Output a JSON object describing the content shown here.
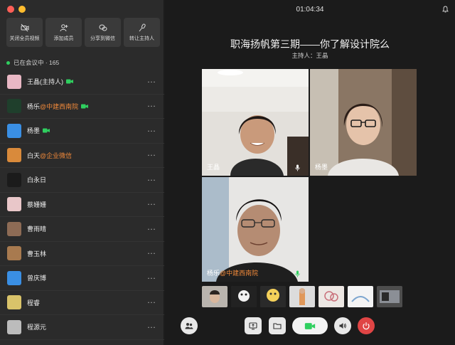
{
  "sidebar": {
    "actions": [
      {
        "label": "关闭全员视频",
        "icon": "camera-off-icon"
      },
      {
        "label": "添加成员",
        "icon": "add-user-icon"
      },
      {
        "label": "分享到微信",
        "icon": "wechat-icon"
      },
      {
        "label": "转让主持人",
        "icon": "microphone-icon"
      }
    ],
    "status": "已在会议中 · 165",
    "members": [
      {
        "name": "王晶(主持人)",
        "org": "",
        "camera": true,
        "avatar_color": "#e8b7c4"
      },
      {
        "name": "杨乐",
        "org": "@中建西南院",
        "camera": true,
        "avatar_color": "#1f3f2c"
      },
      {
        "name": "杨墨",
        "org": "",
        "camera": true,
        "avatar_color": "#3a8fe4"
      },
      {
        "name": "白天",
        "org": "@企业微信",
        "camera": false,
        "avatar_color": "#d98a3b"
      },
      {
        "name": "白永日",
        "org": "",
        "camera": false,
        "avatar_color": "#1b1b1b"
      },
      {
        "name": "蔡姗姗",
        "org": "",
        "camera": false,
        "avatar_color": "#e9c7c9"
      },
      {
        "name": "曹雨晴",
        "org": "",
        "camera": false,
        "avatar_color": "#8d6b55"
      },
      {
        "name": "曹玉林",
        "org": "",
        "camera": false,
        "avatar_color": "#a87a4f"
      },
      {
        "name": "曾庆博",
        "org": "",
        "camera": false,
        "avatar_color": "#3a8fe4"
      },
      {
        "name": "程睿",
        "org": "",
        "camera": false,
        "avatar_color": "#d9c36a"
      },
      {
        "name": "程源元",
        "org": "",
        "camera": false,
        "avatar_color": "#bcbcbc"
      }
    ],
    "more_label": "···"
  },
  "header": {
    "time": "01:04:34",
    "title": "职海扬帆第三期——你了解设计院么",
    "host": "主持人：王晶"
  },
  "videos": [
    {
      "name": "王晶",
      "org": "",
      "mic": false
    },
    {
      "name": "杨墨",
      "org": "",
      "mic": false
    },
    {
      "name": "杨乐",
      "org": "@中建西南院",
      "mic": true
    }
  ],
  "colors": {
    "accent_green": "#2fcf5f",
    "org_orange": "#f0893a",
    "end_red": "#e04545"
  }
}
